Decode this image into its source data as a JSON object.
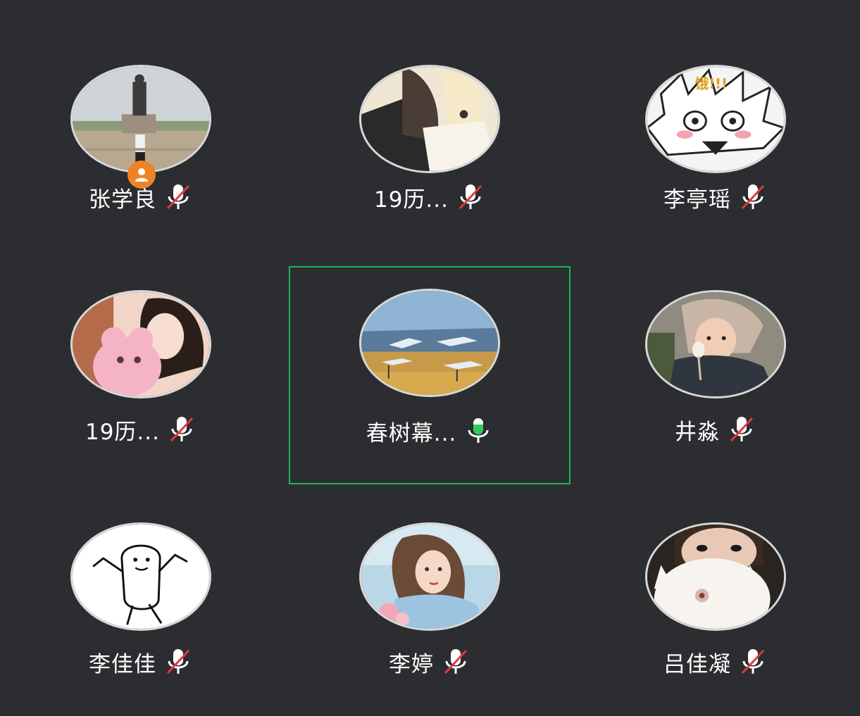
{
  "participants": [
    {
      "name": "张学良",
      "mic": "muted",
      "host": true,
      "active": false,
      "avatar": "statue-photo"
    },
    {
      "name": "19历...",
      "mic": "muted",
      "host": false,
      "active": false,
      "avatar": "anime-couple"
    },
    {
      "name": "李亭瑶",
      "mic": "muted",
      "host": false,
      "active": false,
      "avatar": "manga-face",
      "avatar_text": "饿!!!"
    },
    {
      "name": "19历...",
      "mic": "muted",
      "host": false,
      "active": false,
      "avatar": "girl-with-plush"
    },
    {
      "name": "春树幕...",
      "mic": "speaking",
      "host": false,
      "active": true,
      "avatar": "cranes-photo"
    },
    {
      "name": "井淼",
      "mic": "muted",
      "host": false,
      "active": false,
      "avatar": "baby-photo"
    },
    {
      "name": "李佳佳",
      "mic": "muted",
      "host": false,
      "active": false,
      "avatar": "doodle-figure"
    },
    {
      "name": "李婷",
      "mic": "muted",
      "host": false,
      "active": false,
      "avatar": "girl-portrait"
    },
    {
      "name": "吕佳凝",
      "mic": "muted",
      "host": false,
      "active": false,
      "avatar": "white-cat"
    }
  ],
  "colors": {
    "background": "#2c2d30",
    "active_border": "#1fb35a",
    "host_badge": "#f08226",
    "muted_slash": "#e0393e",
    "speaking_level": "#2ecc5a"
  },
  "icons": {
    "muted": "mic-muted-icon",
    "speaking": "mic-speaking-icon",
    "host": "host-person-icon"
  }
}
